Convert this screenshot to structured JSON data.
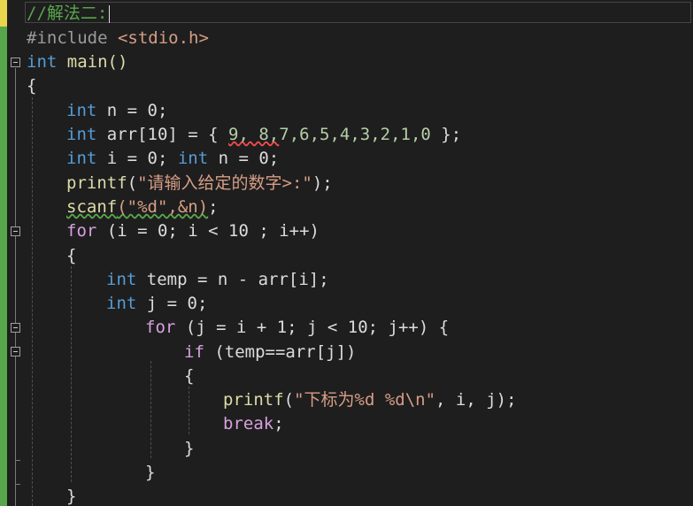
{
  "editor": {
    "lines": {
      "l1": {
        "comment": "//解法二:"
      },
      "l2": {
        "directive": "#include ",
        "header": "<stdio.h>"
      },
      "l3": {
        "type": "int",
        "name": " main()"
      },
      "l4": {
        "text": "{"
      },
      "l5": {
        "type": "int",
        "rest": " n = 0;"
      },
      "l6": {
        "type": "int",
        "decl": " arr[10] = { ",
        "err": "9, 8,",
        "values": "7,6,5,4,3,2,1,0",
        "end": " };"
      },
      "l7": {
        "type1": "int",
        "decl1": " i = 0; ",
        "type2": "int",
        "decl2": " n = 0;"
      },
      "l8": {
        "fn": "printf",
        "open": "(",
        "str": "\"请输入给定的数字>:\"",
        "close": ");"
      },
      "l9": {
        "fn": "scanf",
        "args": "(\"%d\",&n)",
        "close": ";"
      },
      "l10": {
        "kw": "for",
        "rest": " (i = 0; i < 10 ; i++)"
      },
      "l11": {
        "text": "{"
      },
      "l12": {
        "type": "int",
        "rest": " temp = n - arr[i];"
      },
      "l13": {
        "type": "int",
        "rest": " j = 0;"
      },
      "l14": {
        "kw": "for",
        "rest": " (j = i + 1; j < 10; j++) {"
      },
      "l15": {
        "kw": "if",
        "rest": " (temp==arr[j])"
      },
      "l16": {
        "text": "{"
      },
      "l17": {
        "fn": "printf",
        "open": "(",
        "str": "\"下标为%d %d\\n\"",
        "close": ", i, j);"
      },
      "l18": {
        "kw": "break",
        "rest": ";"
      },
      "l19": {
        "text": "}"
      },
      "l20": {
        "text": "}"
      },
      "l21": {
        "text": "}"
      }
    }
  },
  "colors": {
    "background": "#1e1e1e",
    "keyword": "#569cd6",
    "control_keyword": "#d8a0df",
    "function": "#dcdcaa",
    "string": "#d69d85",
    "comment": "#57a64a",
    "number": "#b5cea8",
    "change_bar_saved": "#57a64a",
    "change_bar_unsaved": "#e8d44d"
  }
}
